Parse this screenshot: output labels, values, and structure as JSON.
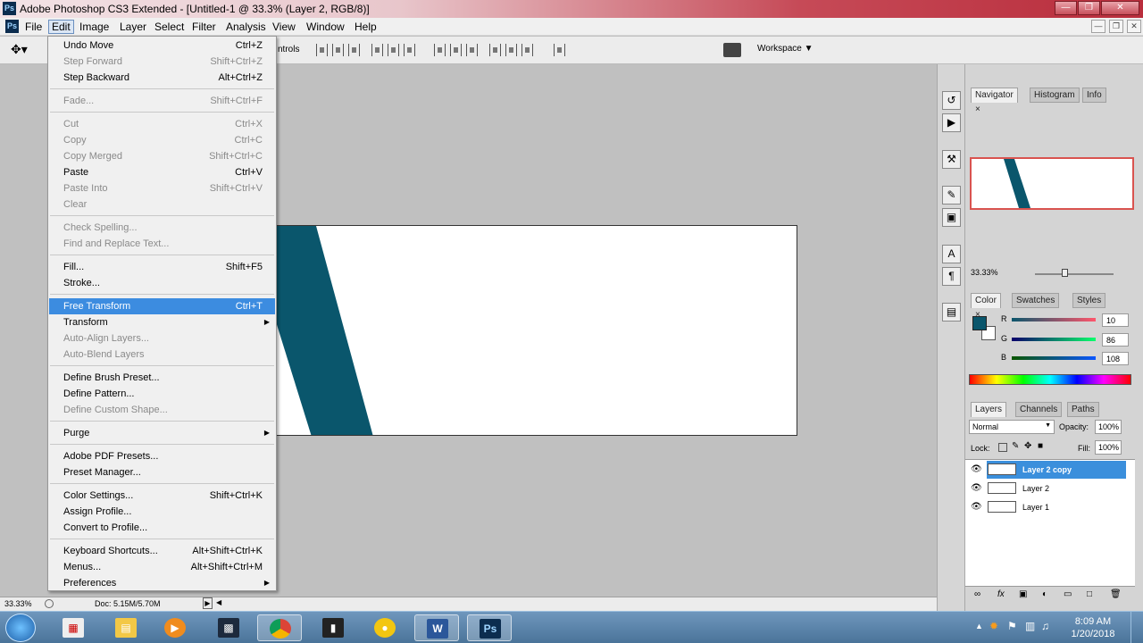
{
  "window": {
    "title": "Adobe Photoshop CS3 Extended - [Untitled-1 @ 33.3% (Layer 2, RGB/8)]",
    "app_icon": "Ps"
  },
  "menubar": {
    "app_icon": "Ps",
    "items": [
      "File",
      "Edit",
      "Image",
      "Layer",
      "Select",
      "Filter",
      "Analysis",
      "View",
      "Window",
      "Help"
    ],
    "active": "Edit"
  },
  "options": {
    "controls_text": "ntrols",
    "workspace_label": "Workspace ▼"
  },
  "status": {
    "zoom": "33.33%",
    "doc_info": "Doc: 5.15M/5.70M"
  },
  "edit_menu": {
    "items": [
      {
        "label": "Undo Move",
        "shortcut": "Ctrl+Z"
      },
      {
        "label": "Step Forward",
        "shortcut": "Shift+Ctrl+Z",
        "disabled": true
      },
      {
        "label": "Step Backward",
        "shortcut": "Alt+Ctrl+Z"
      },
      {
        "label": "Fade...",
        "shortcut": "Shift+Ctrl+F",
        "disabled": true
      },
      {
        "label": "Cut",
        "shortcut": "Ctrl+X",
        "disabled": true
      },
      {
        "label": "Copy",
        "shortcut": "Ctrl+C",
        "disabled": true
      },
      {
        "label": "Copy Merged",
        "shortcut": "Shift+Ctrl+C",
        "disabled": true
      },
      {
        "label": "Paste",
        "shortcut": "Ctrl+V"
      },
      {
        "label": "Paste Into",
        "shortcut": "Shift+Ctrl+V",
        "disabled": true
      },
      {
        "label": "Clear",
        "shortcut": "",
        "disabled": true
      },
      {
        "label": "Check Spelling...",
        "shortcut": "",
        "disabled": true
      },
      {
        "label": "Find and Replace Text...",
        "shortcut": "",
        "disabled": true
      },
      {
        "label": "Fill...",
        "shortcut": "Shift+F5"
      },
      {
        "label": "Stroke...",
        "shortcut": ""
      },
      {
        "label": "Free Transform",
        "shortcut": "Ctrl+T",
        "highlight": true
      },
      {
        "label": "Transform",
        "shortcut": "",
        "submenu": true
      },
      {
        "label": "Auto-Align Layers...",
        "shortcut": "",
        "disabled": true
      },
      {
        "label": "Auto-Blend Layers",
        "shortcut": "",
        "disabled": true
      },
      {
        "label": "Define Brush Preset...",
        "shortcut": ""
      },
      {
        "label": "Define Pattern...",
        "shortcut": ""
      },
      {
        "label": "Define Custom Shape...",
        "shortcut": "",
        "disabled": true
      },
      {
        "label": "Purge",
        "shortcut": "",
        "submenu": true
      },
      {
        "label": "Adobe PDF Presets...",
        "shortcut": ""
      },
      {
        "label": "Preset Manager...",
        "shortcut": ""
      },
      {
        "label": "Color Settings...",
        "shortcut": "Shift+Ctrl+K"
      },
      {
        "label": "Assign Profile...",
        "shortcut": ""
      },
      {
        "label": "Convert to Profile...",
        "shortcut": ""
      },
      {
        "label": "Keyboard Shortcuts...",
        "shortcut": "Alt+Shift+Ctrl+K"
      },
      {
        "label": "Menus...",
        "shortcut": "Alt+Shift+Ctrl+M"
      },
      {
        "label": "Preferences",
        "shortcut": "",
        "submenu": true
      }
    ]
  },
  "navigator_panel": {
    "tabs": [
      "Navigator",
      "Histogram",
      "Info"
    ],
    "zoom": "33.33%"
  },
  "color_panel": {
    "tabs": [
      "Color",
      "Swatches",
      "Styles"
    ],
    "r_label": "R",
    "g_label": "G",
    "b_label": "B",
    "r": "10",
    "g": "86",
    "b": "108",
    "foreground": "#0a566c"
  },
  "layers_panel": {
    "tabs": [
      "Layers",
      "Channels",
      "Paths"
    ],
    "blend_mode": "Normal",
    "opacity_label": "Opacity:",
    "opacity": "100%",
    "lock_label": "Lock:",
    "fill_label": "Fill:",
    "fill": "100%",
    "layers": [
      {
        "name": "Layer 2 copy",
        "selected": true
      },
      {
        "name": "Layer 2"
      },
      {
        "name": "Layer 1"
      }
    ]
  },
  "taskbar": {
    "time": "8:09 AM",
    "date": "1/20/2018"
  },
  "colors": {
    "stripe": "#0a566c",
    "menu_highlight": "#3c8ce0"
  }
}
